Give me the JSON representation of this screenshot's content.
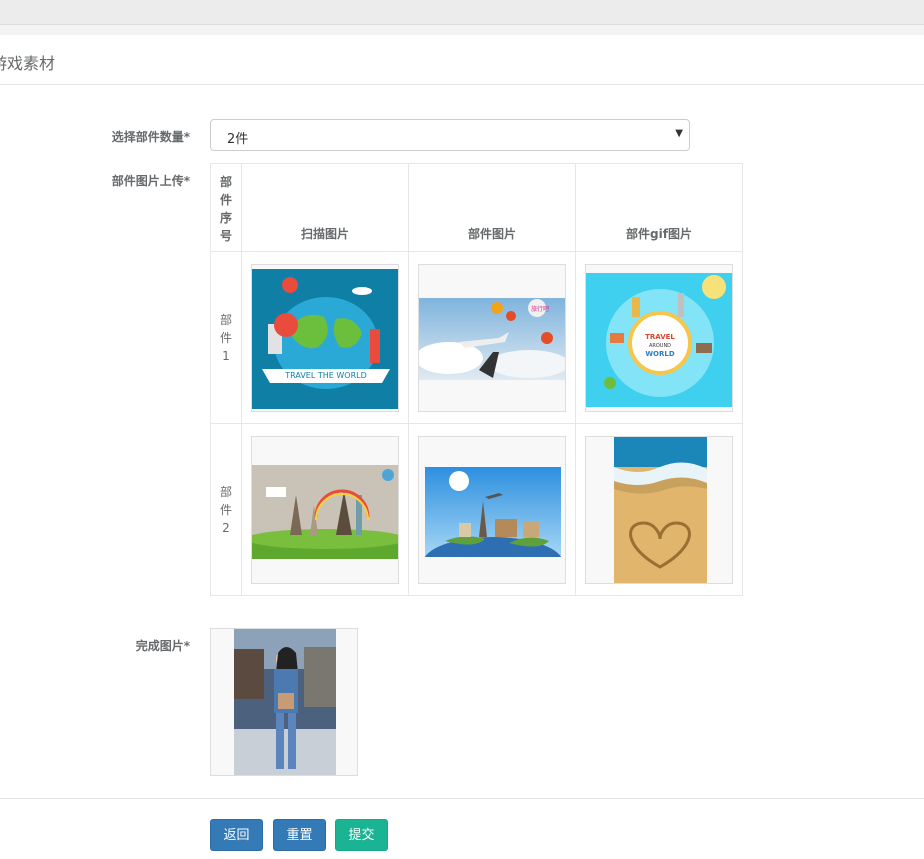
{
  "page": {
    "title": "游戏素材"
  },
  "form": {
    "count_label": "选择部件数量*",
    "count_value": "2件",
    "upload_label": "部件图片上传*",
    "finish_label": "完成图片*"
  },
  "table": {
    "headers": [
      "部件序号",
      "扫描图片",
      "部件图片",
      "部件gif图片"
    ],
    "idx_header_chars": [
      "部",
      "件",
      "序",
      "号"
    ],
    "rows": [
      {
        "label_chars": [
          "部",
          "件",
          "1"
        ],
        "images": [
          "travel-the-world-scan",
          "hot-air-balloons-part",
          "travel-world-globe-gif"
        ]
      },
      {
        "label_chars": [
          "部",
          "件",
          "2"
        ],
        "images": [
          "landmarks-scan",
          "world-landmarks-part",
          "beach-heart-gif"
        ]
      }
    ]
  },
  "images": {
    "img1_text": "TRAVEL THE WORLD",
    "img3_text1": "TRAVEL",
    "img3_text2": "AROUND",
    "img3_text3": "WORLD",
    "img2_text": "旅行吧"
  },
  "buttons": {
    "back": "返回",
    "reset": "重置",
    "submit": "提交"
  },
  "colors": {
    "primary": "#337ab7",
    "success": "#1ab394"
  }
}
